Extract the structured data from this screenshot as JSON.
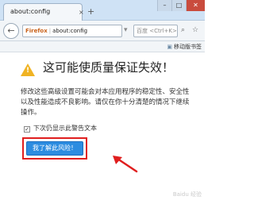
{
  "window": {
    "tab_title": "about:config",
    "tab_close": "×",
    "new_tab": "+",
    "minimize": "–",
    "maximize": "□",
    "close": "✕"
  },
  "toolbar": {
    "back_glyph": "←",
    "url_badge": "Firefox",
    "url": "about:config",
    "search_placeholder": "百度 <Ctrl+K>",
    "mobile_bookmarks": "移动版书签"
  },
  "content": {
    "title": "这可能使质量保证失效！",
    "warning": "修改这些高级设置可能会对本应用程序的稳定性、安全性以及性能造成不良影响。请仅在你十分清楚的情况下继续操作。",
    "checkbox_label": "下次仍显示此警告文本",
    "checkbox_checked": true,
    "accept_button": "我了解此风险！",
    "watermark": "Baidu 经验"
  },
  "colors": {
    "accent": "#2c8ce0",
    "highlight": "#e01e1e",
    "warning": "#f0b323"
  }
}
